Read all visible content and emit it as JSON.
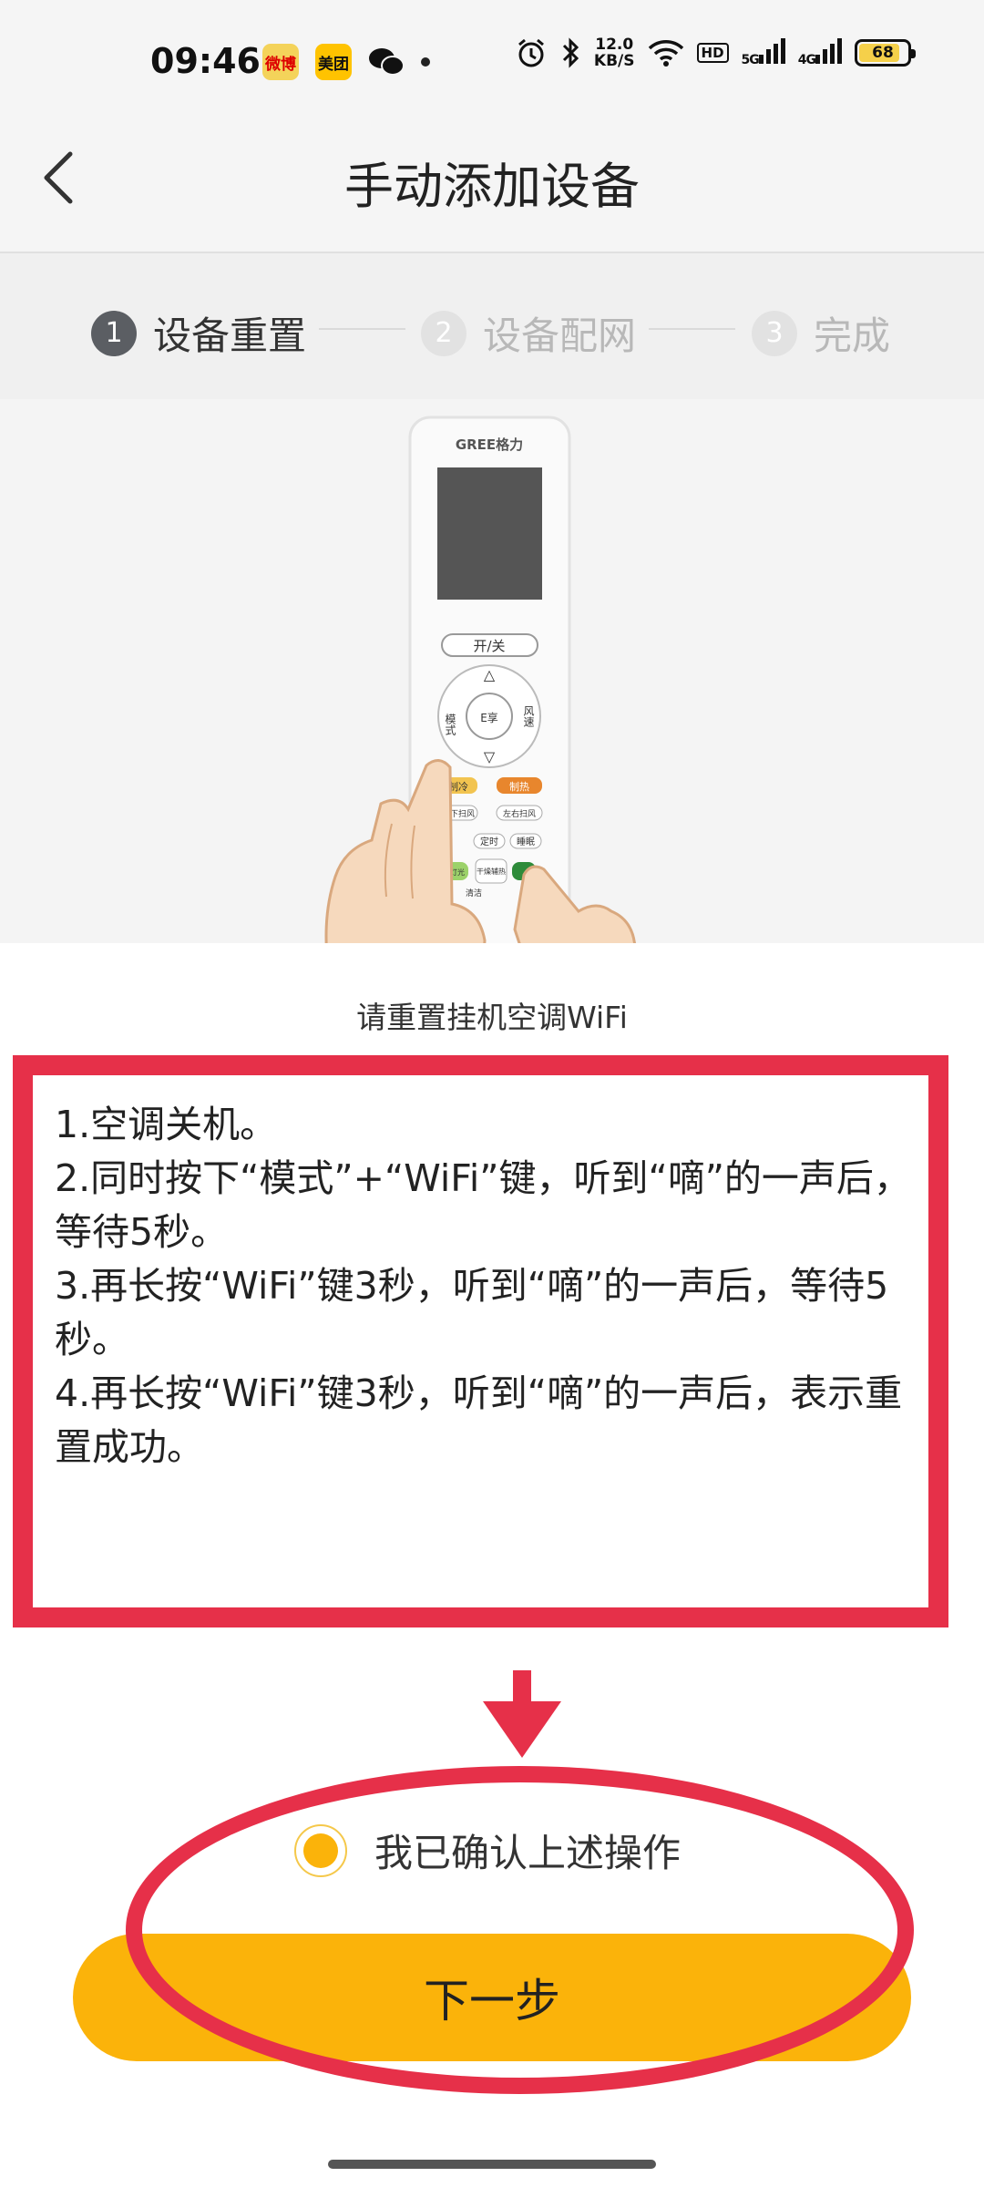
{
  "status_bar": {
    "time": "09:46",
    "apps": {
      "weibo": "微博",
      "meituan": "美团",
      "wechat": "wechat-icon"
    },
    "net_speed": {
      "value": "12.0",
      "unit": "KB/S"
    },
    "hd_label": "HD",
    "sim1": "5G",
    "sim2": "4G",
    "battery": "68"
  },
  "header": {
    "title": "手动添加设备"
  },
  "steps": [
    {
      "num": "1",
      "label": "设备重置",
      "state": "active"
    },
    {
      "num": "2",
      "label": "设备配网",
      "state": "inactive"
    },
    {
      "num": "3",
      "label": "完成",
      "state": "inactive"
    }
  ],
  "remote": {
    "brand": "GREE格力",
    "power": "开/关",
    "mode": "模式",
    "fan": "风速",
    "center": "E享",
    "cool": "制冷",
    "heat": "制热",
    "swing_lr": "左右扫风",
    "swing_ud": "上下扫风",
    "timer": "定时",
    "sleep": "睡眠",
    "dry": "干燥辅热",
    "clean": "清洁",
    "light": "灯光"
  },
  "instruction": {
    "title": "请重置挂机空调WiFi",
    "lines": [
      "1.空调关机。",
      "2.同时按下“模式”+“WiFi”键，听到“嘀”的一声后，等待5秒。",
      "3.再长按“WiFi”键3秒，听到“嘀”的一声后，等待5秒。",
      "4.再长按“WiFi”键3秒，听到“嘀”的一声后，表示重置成功。"
    ]
  },
  "confirm": {
    "label": "我已确认上述操作",
    "checked": true
  },
  "next_button": {
    "label": "下一步"
  },
  "colors": {
    "accent": "#fbb30a",
    "annotation": "#e63049",
    "step_active": "#5b5e63"
  }
}
